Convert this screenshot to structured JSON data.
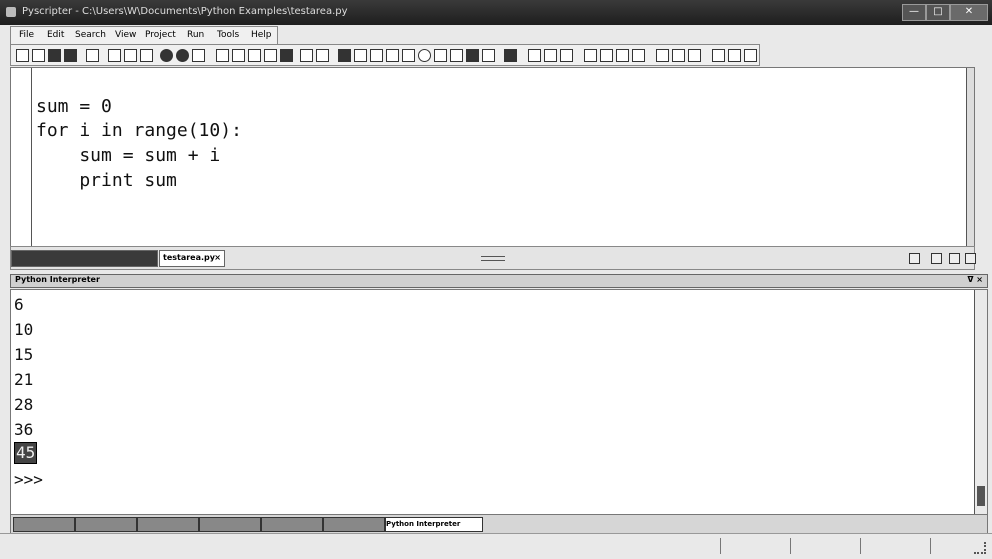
{
  "window": {
    "title": "Pyscripter - C:\\Users\\W\\Documents\\Python Examples\\testarea.py",
    "buttons": [
      "—",
      "□",
      "✕"
    ]
  },
  "menu": [
    "File",
    "Edit",
    "Search",
    "View",
    "Project",
    "Run",
    "Tools",
    "Help"
  ],
  "editor": {
    "lines": [
      "sum = 0",
      "for i in range(10):",
      "    sum = sum + i",
      "    print sum"
    ]
  },
  "editor_tabs": {
    "active": "testarea.py",
    "close": "×"
  },
  "interpreter": {
    "title": "Python Interpreter",
    "pane_controls": "ᐁ ×",
    "output": [
      "6",
      "10",
      "15",
      "21",
      "28",
      "36",
      "45"
    ],
    "prompt": ">>>"
  },
  "bottom_tabs": {
    "active": "Python Interpreter"
  }
}
